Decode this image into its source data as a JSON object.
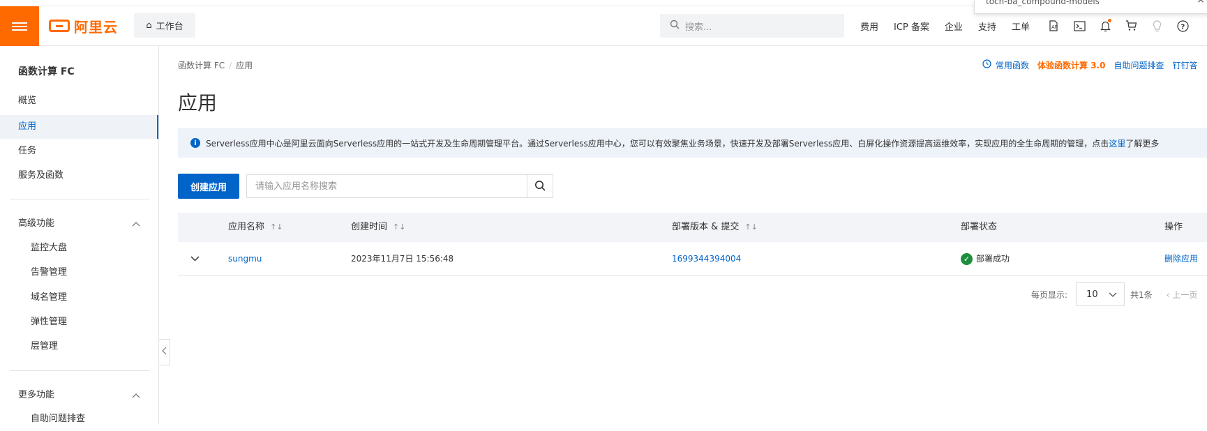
{
  "header": {
    "logo_text": "阿里云",
    "workbench": "工作台",
    "search_placeholder": "搜索...",
    "links": [
      "费用",
      "ICP 备案",
      "企业",
      "支持",
      "工单"
    ],
    "popup_text": "toch-ba_compound-models"
  },
  "sidebar": {
    "title": "函数计算 FC",
    "items": [
      "概览",
      "应用",
      "任务",
      "服务及函数"
    ],
    "active_item": "应用",
    "advanced": {
      "label": "高级功能",
      "items": [
        "监控大盘",
        "告警管理",
        "域名管理",
        "弹性管理",
        "层管理"
      ]
    },
    "more": {
      "label": "更多功能",
      "items": [
        "自助问题排查"
      ]
    }
  },
  "breadcrumb": {
    "root": "函数计算 FC",
    "current": "应用"
  },
  "page_title": "应用",
  "top_links": {
    "common_functions": "常用函数",
    "try_fc3": "体验函数计算 3.0",
    "self_troubleshoot": "自助问题排查",
    "dingtalk": "钉钉答"
  },
  "notice": {
    "text": "Serverless应用中心是阿里云面向Serverless应用的一站式开发及生命周期管理平台。通过Serverless应用中心，您可以有效聚焦业务场景，快速开发及部署Serverless应用、白屏化操作资源提高运维效率，实现应用的全生命周期的管理，点击",
    "link": "这里",
    "tail": "了解更多"
  },
  "toolbar": {
    "create_button": "创建应用",
    "search_placeholder": "请输入应用名称搜索"
  },
  "table": {
    "columns": [
      "应用名称",
      "创建时间",
      "部署版本 & 提交",
      "部署状态",
      "操作"
    ],
    "rows": [
      {
        "name": "sungmu",
        "created": "2023年11月7日 15:56:48",
        "version": "1699344394004",
        "status": "部署成功",
        "action": "删除应用"
      }
    ]
  },
  "pagination": {
    "page_size_label": "每页显示:",
    "page_size": "10",
    "total": "共1条",
    "prev": "上一页"
  },
  "colors": {
    "brand": "#ff6a00",
    "primary": "#0064c8",
    "success": "#1e8e3e"
  }
}
